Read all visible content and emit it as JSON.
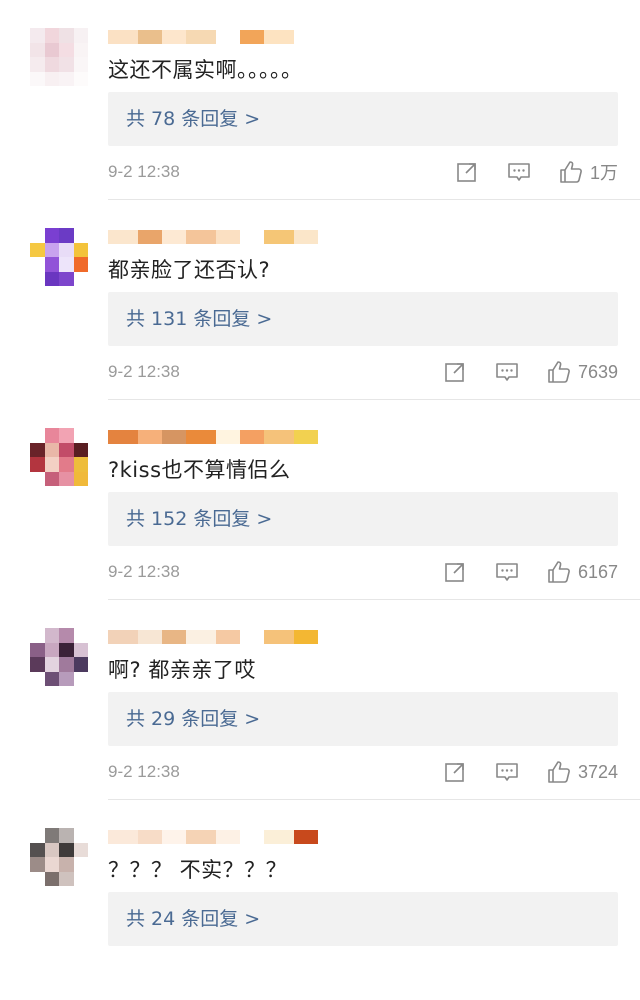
{
  "comments": [
    {
      "text": "这还不属实啊。。。。。",
      "replies": "共 78 条回复 >",
      "time": "9-2 12:38",
      "likes": "1万",
      "avatar": [
        "#f4eaee",
        "#f1d6dc",
        "#efe1e5",
        "#f7f1f3",
        "#f2e4e8",
        "#e9c9d2",
        "#f4dde3",
        "#f9f4f5",
        "#f5ebee",
        "#efd9df",
        "#f1e1e6",
        "#faf6f7",
        "#fbf8f9",
        "#f8f0f2",
        "#f9f3f5",
        "#fdfbfb"
      ],
      "name": [
        "#fbe1c4",
        "#eabf8c",
        "#fde6cc",
        "#f6d9b3",
        "#ffffff",
        "#f2a559",
        "#fde3c1"
      ]
    },
    {
      "text": "都亲脸了还否认?",
      "replies": "共 131 条回复 >",
      "time": "9-2 12:38",
      "likes": "7639",
      "avatar": [
        "#ffffff",
        "#7a3fd1",
        "#6b3bc5",
        "#ffffff",
        "#f5c842",
        "#c8a3ee",
        "#e8dcf7",
        "#f3c33b",
        "#ffffff",
        "#9153d8",
        "#ede4fa",
        "#f06a2a",
        "#ffffff",
        "#6a36c0",
        "#7d45cc",
        "#ffffff"
      ],
      "name": [
        "#fbe6cd",
        "#e9a56a",
        "#fde9d3",
        "#f4c59a",
        "#fbe0c2",
        "#ffffff",
        "#f5c676",
        "#fbe6c9"
      ]
    },
    {
      "text": "?kiss也不算情侣么",
      "replies": "共 152 条回复 >",
      "time": "9-2 12:38",
      "likes": "6167",
      "avatar": [
        "#ffffff",
        "#e8869a",
        "#f2a3b3",
        "#ffffff",
        "#6a2329",
        "#e9b7a8",
        "#c24c68",
        "#5a1e22",
        "#b3353f",
        "#f3d0c4",
        "#e27b8a",
        "#eebd3b",
        "#ffffff",
        "#c6607a",
        "#e691a3",
        "#f0b93a"
      ],
      "name": [
        "#e4833f",
        "#f6b07a",
        "#d69562",
        "#ea8a3a",
        "#fff4e0",
        "#f4a062",
        "#f5c27a",
        "#f2d150"
      ]
    },
    {
      "text": "啊? 都亲亲了哎",
      "replies": "共 29 条回复 >",
      "time": "9-2 12:38",
      "likes": "3724",
      "avatar": [
        "#ffffff",
        "#d2b8cc",
        "#b58aab",
        "#ffffff",
        "#8a6087",
        "#c8a7c0",
        "#3b2238",
        "#d7c1d3",
        "#5b3a5a",
        "#e3d3df",
        "#a07a9c",
        "#4c3a5f",
        "#ffffff",
        "#6d4f75",
        "#b79bbb",
        "#ffffff"
      ],
      "name": [
        "#f2d2b8",
        "#f7e6d4",
        "#e8b685",
        "#fbf0e2",
        "#f5c9a3",
        "#ffffff",
        "#f5c27a",
        "#f3b733"
      ]
    },
    {
      "text": "？？？ 不实？？？",
      "replies": "共 24 条回复 >",
      "time": "",
      "likes": "",
      "avatar": [
        "#ffffff",
        "#7f7a78",
        "#bab3b1",
        "#ffffff",
        "#545050",
        "#d8c7c2",
        "#3f3b3a",
        "#e8dcd8",
        "#9c8c88",
        "#ead7d2",
        "#c8b2ac",
        "#ffffff",
        "#ffffff",
        "#7b6f6c",
        "#cfc2be",
        "#ffffff"
      ],
      "name": [
        "#fbe9da",
        "#f7dcc7",
        "#fef3ea",
        "#f5d3b5",
        "#fdf1e5",
        "#ffffff",
        "#fbefd8",
        "#c8491c"
      ]
    }
  ],
  "icon_names": {
    "share": "share-icon",
    "comment": "comment-icon",
    "like": "like-icon"
  }
}
